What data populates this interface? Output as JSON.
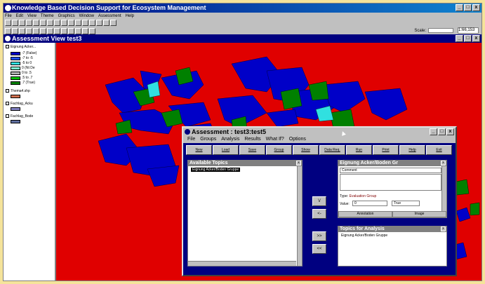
{
  "app": {
    "title": "Knowledge Based Decision Support for Ecosystem Management",
    "menu": [
      "File",
      "Edit",
      "View",
      "Theme",
      "Graphics",
      "Window",
      "Assessment",
      "Help"
    ],
    "scale_label": "Scale:",
    "scale_value": "1:66,153"
  },
  "assessment_view": {
    "title": "Assessment View test3"
  },
  "legend": {
    "layer_title": "Eignung Acker...",
    "items": [
      {
        "label": "-7 (False)",
        "color": "#0000c8"
      },
      {
        "label": "-7 to -5",
        "color": "#2050ff"
      },
      {
        "label": "-5 to 0",
        "color": "#30e0e0"
      },
      {
        "label": "0 (Nt De",
        "color": "#7fffd4"
      },
      {
        "label": "0 to .5",
        "color": "#b0b0b0"
      },
      {
        "label": ".5 to .7",
        "color": "#00c000"
      },
      {
        "label": ".7 (True)",
        "color": "#008000"
      }
    ],
    "sections": [
      "Thema4.shp",
      "Fachlag_Acku",
      "Fachlag_Bode"
    ]
  },
  "dialog": {
    "title": "Assessment : test3:test5",
    "menu": [
      "File",
      "Groups",
      "Analysis",
      "Results",
      "What If?",
      "Options"
    ],
    "buttons": [
      "New",
      "Load",
      "Save",
      "Group",
      "Show",
      "Data Req.",
      "Run",
      "Print",
      "Help",
      "Exit"
    ],
    "available_topics_header": "Available Topics",
    "available_topics": [
      "Eignung Acker/Boden Gruppe"
    ],
    "move_down": "\\/",
    "move_left": "<-",
    "add": ">>",
    "remove": "<<",
    "eignung_header": "Eignung Acker/Boden Gr",
    "comment_label": "Comment",
    "type_label": "Type:",
    "type_value": "Evaluation Group",
    "value_label": "Value:",
    "value_value": "0",
    "value_select": "True",
    "annotation_tab": "Annotation",
    "image_tab": "Image",
    "topics_analysis_header": "Topics for Analysis",
    "topics_for_analysis": [
      "Eignung Acker/Boden Gruppe"
    ]
  },
  "colors": {
    "map_background": "#e00000",
    "false_blue": "#0000c8",
    "true_green": "#008000",
    "cyan": "#30e0e0"
  }
}
